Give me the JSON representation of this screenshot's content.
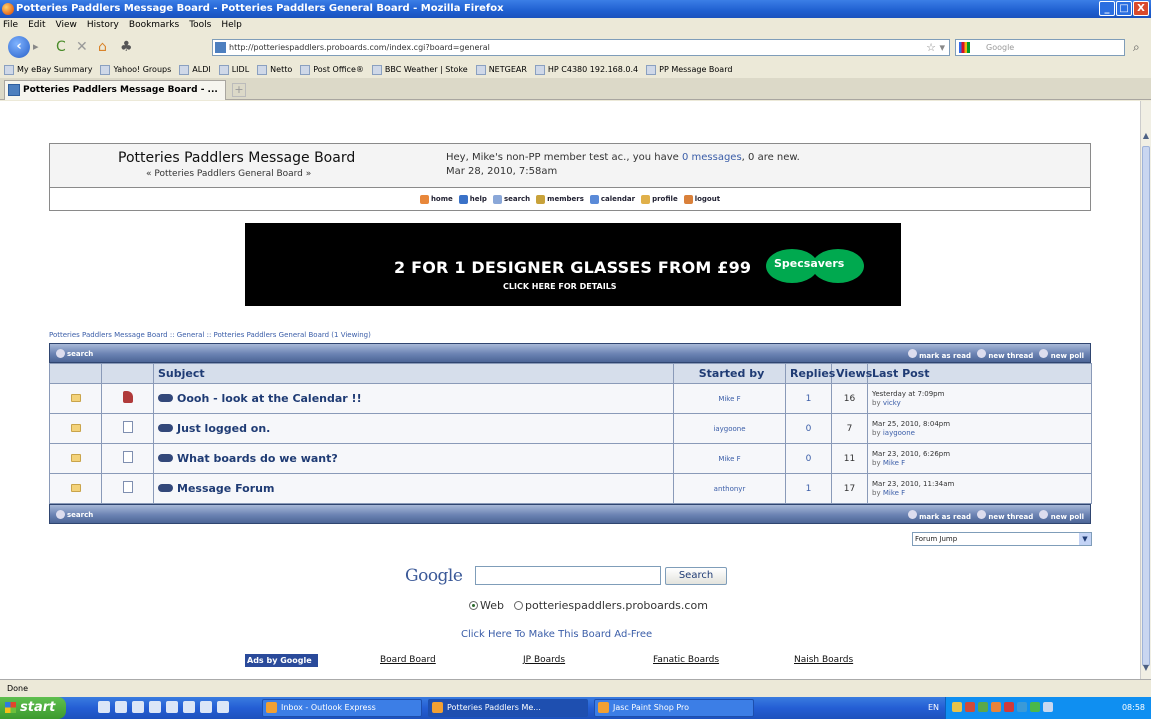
{
  "window": {
    "title": "Potteries Paddlers Message Board - Potteries Paddlers General Board - Mozilla Firefox",
    "buttons": [
      "_",
      "□",
      "X"
    ]
  },
  "menu": [
    "File",
    "Edit",
    "View",
    "History",
    "Bookmarks",
    "Tools",
    "Help"
  ],
  "nav": {
    "url": "http://potteriespaddlers.proboards.com/index.cgi?board=general",
    "search_placeholder": "Google"
  },
  "bookmarks": [
    "My eBay Summary",
    "Yahoo! Groups",
    "ALDI",
    "LIDL",
    "Netto",
    "Post Office®",
    "BBC Weather | Stoke",
    "NETGEAR",
    "HP C4380 192.168.0.4",
    "PP Message Board"
  ],
  "tab": {
    "label": "Potteries Paddlers Message Board - ..."
  },
  "board": {
    "title": "Potteries Paddlers Message Board",
    "subtitle": "« Potteries Paddlers General Board »",
    "greeting_pre": "Hey, Mike's non-PP member test ac., you have ",
    "messages_link": "0 messages",
    "greeting_post": ", 0 are new.",
    "datetime": "Mar 28, 2010, 7:58am",
    "menu": [
      "home",
      "help",
      "search",
      "members",
      "calendar",
      "profile",
      "logout"
    ]
  },
  "ad": {
    "headline": "2 FOR 1 DESIGNER GLASSES FROM £99",
    "sub": "CLICK HERE FOR DETAILS",
    "brand": "Specsavers"
  },
  "breadcrumb": "Potteries Paddlers Message Board :: General :: Potteries Paddlers General Board (1 Viewing)",
  "threadbar": {
    "search": "search",
    "actions": [
      "mark as read",
      "new thread",
      "new poll"
    ]
  },
  "table": {
    "headers": [
      "Subject",
      "Started by",
      "Replies",
      "Views",
      "Last Post"
    ],
    "rows": [
      {
        "subject": "Oooh - look at the Calendar !!",
        "starter": "Mike F",
        "replies": "1",
        "views": "16",
        "last_date": "Yesterday at 7:09pm",
        "last_by": "vicky",
        "hot": true
      },
      {
        "subject": "Just logged on.",
        "starter": "iaygoone",
        "replies": "0",
        "views": "7",
        "last_date": "Mar 25, 2010, 8:04pm",
        "last_by": "iaygoone",
        "hot": false
      },
      {
        "subject": "What boards do we want?",
        "starter": "Mike F",
        "replies": "0",
        "views": "11",
        "last_date": "Mar 23, 2010, 6:26pm",
        "last_by": "Mike F",
        "hot": false
      },
      {
        "subject": "Message Forum",
        "starter": "anthonyr",
        "replies": "1",
        "views": "17",
        "last_date": "Mar 23, 2010, 11:34am",
        "last_by": "Mike F",
        "hot": false
      }
    ],
    "by_label": "by"
  },
  "forum_jump": "Forum Jump",
  "google": {
    "logo": "Google",
    "button": "Search",
    "radio_web": "Web",
    "radio_site": "potteriespaddlers.proboards.com"
  },
  "adfree": "Click Here To Make This Board Ad-Free",
  "adsbar": {
    "label": "Ads by Google",
    "links": [
      "Board Board",
      "JP Boards",
      "Fanatic Boards",
      "Naish Boards"
    ]
  },
  "status": "Done",
  "taskbar": {
    "start": "start",
    "tasks": [
      "Inbox - Outlook Express",
      "Potteries Paddlers Me...",
      "Jasc Paint Shop Pro"
    ],
    "lang": "EN",
    "clock": "08:58"
  },
  "colors": {
    "titlebar": "#1f5fd0",
    "link": "#3a5da8",
    "table_header": "#d6deeb",
    "bar": "#6b83b3",
    "ad_green": "#00a94f"
  }
}
